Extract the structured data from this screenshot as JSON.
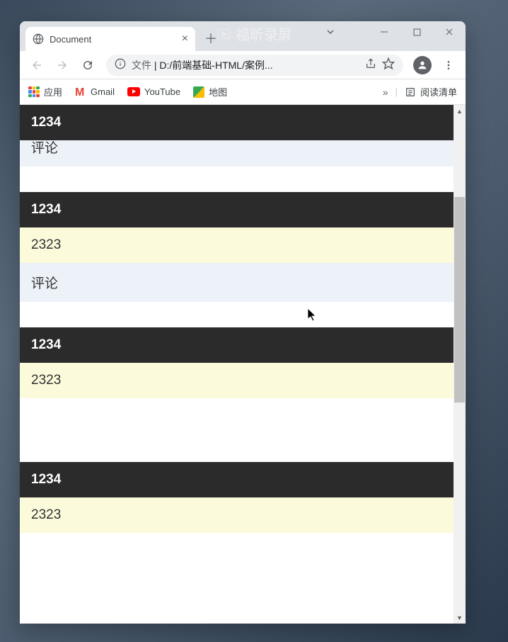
{
  "watermark": {
    "text": "福昕录屏"
  },
  "browser": {
    "tab_title": "Document",
    "address_prefix": "文件",
    "address_path": "D:/前端基础-HTML/案例...",
    "bookmarks": {
      "apps": "应用",
      "gmail": "Gmail",
      "youtube": "YouTube",
      "maps": "地图",
      "overflow": "»",
      "reading_list": "阅读清单"
    }
  },
  "cards": [
    {
      "header": "1234",
      "body": "",
      "footer": "评论",
      "partial_top": true
    },
    {
      "header": "1234",
      "body": "2323",
      "footer": "评论"
    },
    {
      "header": "1234",
      "body": "2323",
      "footer": ""
    },
    {
      "header": "1234",
      "body": "2323",
      "footer": ""
    }
  ]
}
